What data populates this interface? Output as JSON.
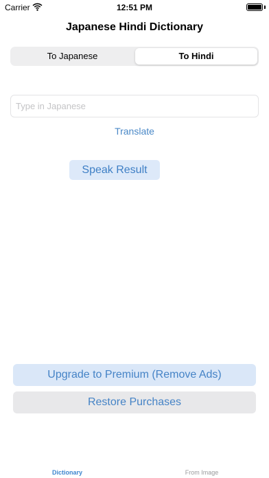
{
  "status_bar": {
    "carrier": "Carrier",
    "time": "12:51 PM",
    "icons": [
      "wifi-icon",
      "battery-icon"
    ]
  },
  "nav": {
    "title": "Japanese Hindi Dictionary"
  },
  "segmented_control": {
    "segments": [
      "To Japanese",
      "To Hindi"
    ],
    "selected": "To Hindi"
  },
  "input": {
    "placeholder": "Type in Japanese",
    "value": ""
  },
  "actions": {
    "translate_label": "Translate",
    "speak_label": "Speak Result",
    "upgrade_label": "Upgrade to Premium (Remove Ads)",
    "restore_label": "Restore Purchases"
  },
  "tab_bar": {
    "tabs": [
      "Dictionary",
      "From Image"
    ],
    "selected": "Dictionary"
  },
  "colors": {
    "accent": "#3d86cf",
    "button_tint": "#dae7f8",
    "secondary_button": "#e8e8ea",
    "inactive_tab": "#9a9a9c"
  }
}
